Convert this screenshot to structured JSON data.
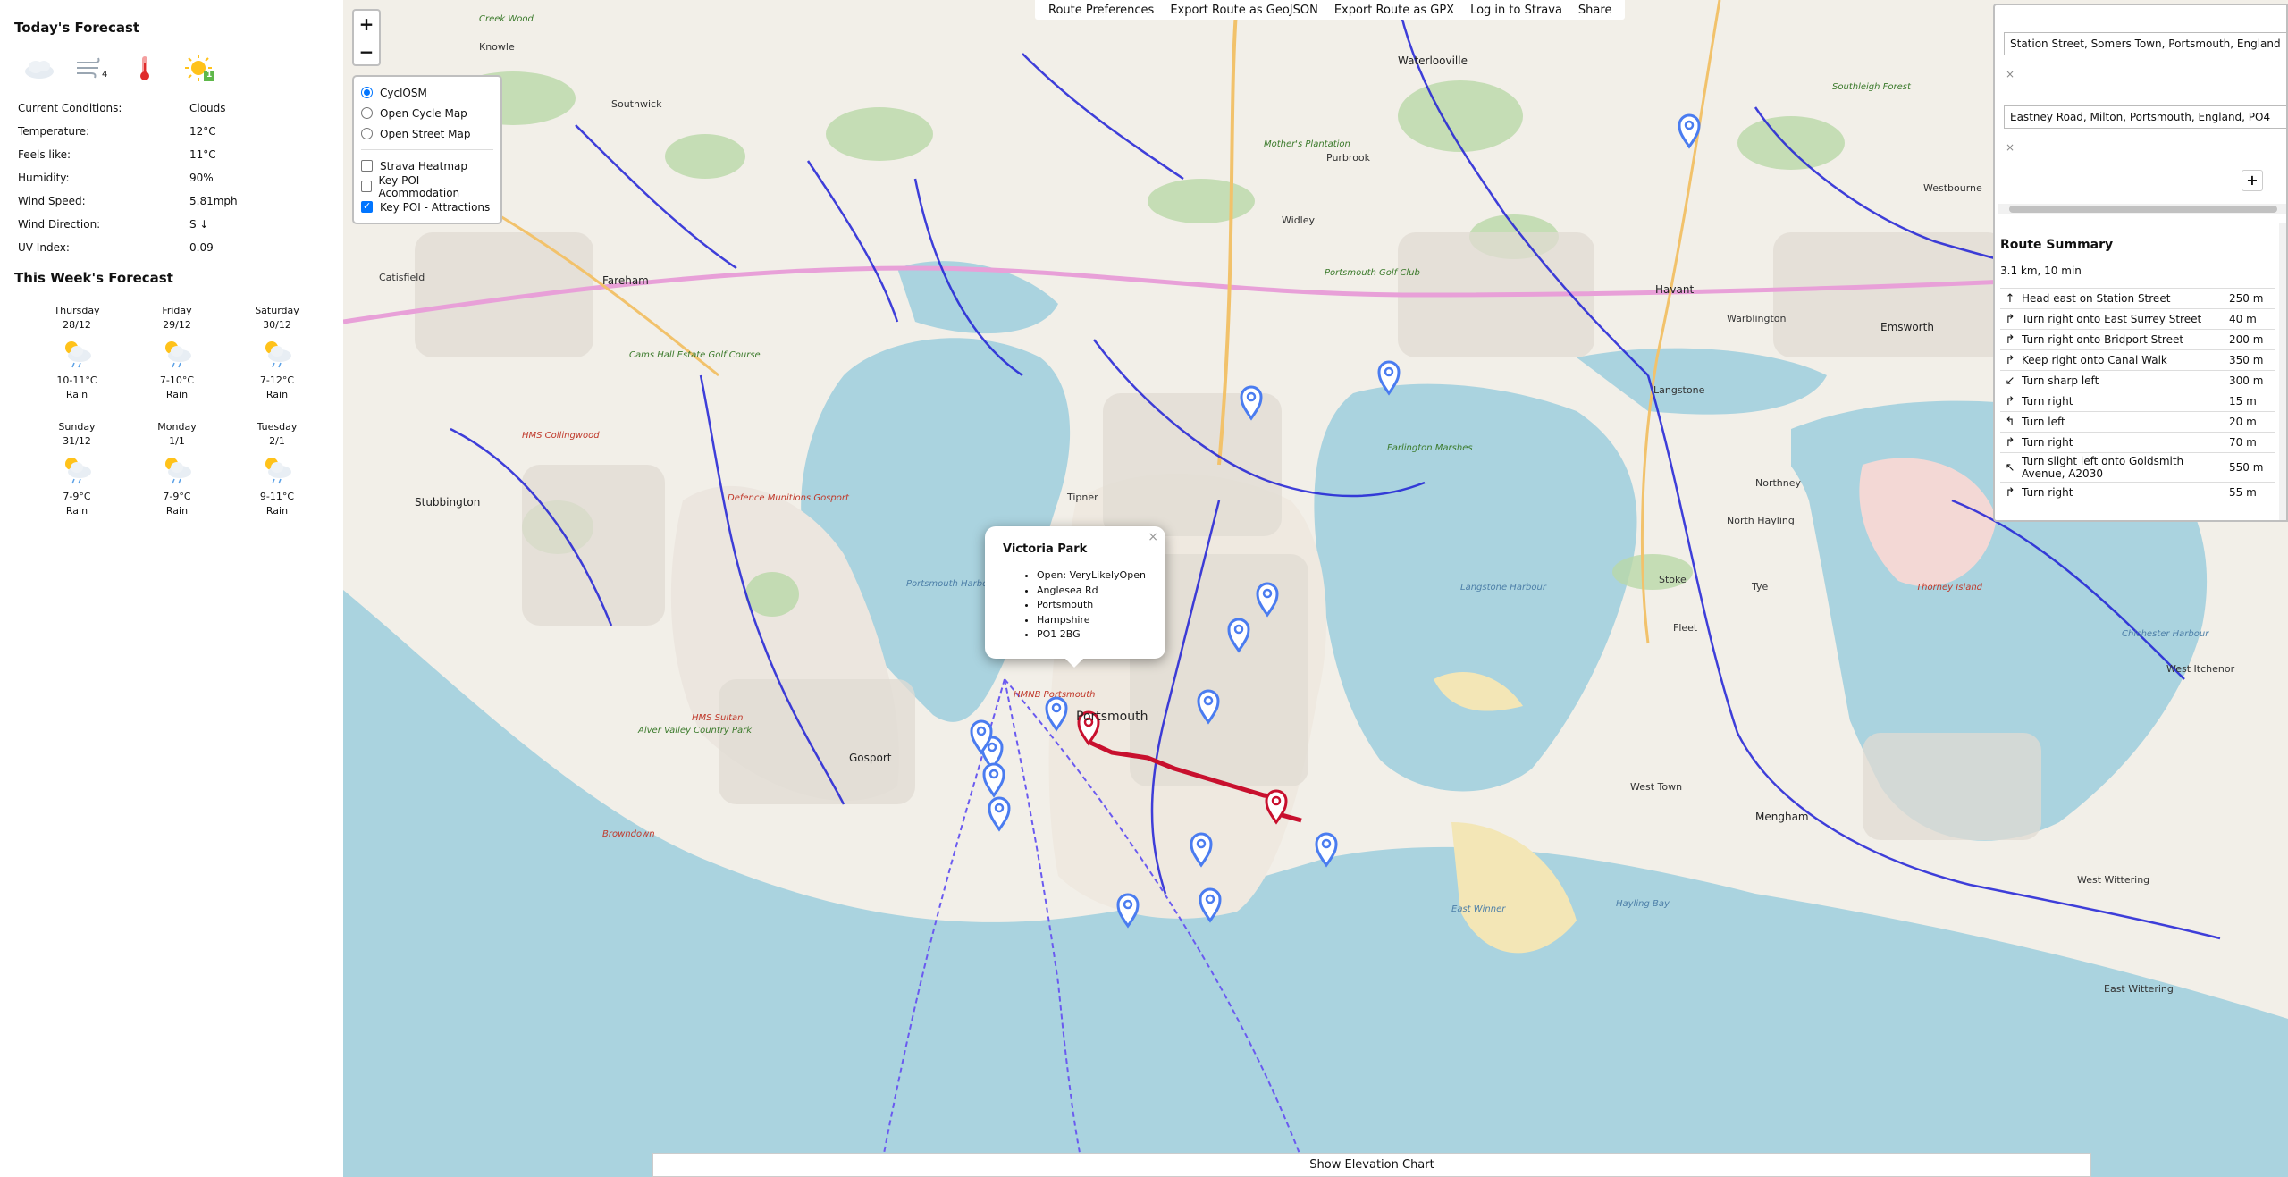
{
  "weather": {
    "today_title": "Today's Forecast",
    "today_icons": [
      {
        "icon": "cloud-icon"
      },
      {
        "icon": "wind-icon",
        "value": "4"
      },
      {
        "icon": "thermometer-icon"
      },
      {
        "icon": "uv-sun-icon",
        "value": "1"
      }
    ],
    "conditions": [
      {
        "label": "Current Conditions:",
        "value": "Clouds"
      },
      {
        "label": "Temperature:",
        "value": "12°C"
      },
      {
        "label": "Feels like:",
        "value": "11°C"
      },
      {
        "label": "Humidity:",
        "value": "90%"
      },
      {
        "label": "Wind Speed:",
        "value": "5.81mph"
      },
      {
        "label": "Wind Direction:",
        "value": "S ↓"
      },
      {
        "label": "UV Index:",
        "value": "0.09"
      }
    ],
    "week_title": "This Week's Forecast",
    "days": [
      {
        "day": "Thursday",
        "date": "28/12",
        "temp": "10-11°C",
        "cond": "Rain"
      },
      {
        "day": "Friday",
        "date": "29/12",
        "temp": "7-10°C",
        "cond": "Rain"
      },
      {
        "day": "Saturday",
        "date": "30/12",
        "temp": "7-12°C",
        "cond": "Rain"
      },
      {
        "day": "Sunday",
        "date": "31/12",
        "temp": "7-9°C",
        "cond": "Rain"
      },
      {
        "day": "Monday",
        "date": "1/1",
        "temp": "7-9°C",
        "cond": "Rain"
      },
      {
        "day": "Tuesday",
        "date": "2/1",
        "temp": "9-11°C",
        "cond": "Rain"
      }
    ]
  },
  "map": {
    "zoom_in": "+",
    "zoom_out": "−",
    "layers": {
      "base": [
        {
          "label": "CyclOSM",
          "selected": true
        },
        {
          "label": "Open Cycle Map",
          "selected": false
        },
        {
          "label": "Open Street Map",
          "selected": false
        }
      ],
      "overlays": [
        {
          "label": "Strava Heatmap",
          "checked": false
        },
        {
          "label": "Key POI - Acommodation",
          "checked": false
        },
        {
          "label": "Key POI - Attractions",
          "checked": true
        }
      ]
    },
    "menu": [
      "Route Preferences",
      "Export Route as GeoJSON",
      "Export Route as GPX",
      "Log in to Strava",
      "Share"
    ],
    "popup": {
      "title": "Victoria Park",
      "close": "×",
      "items": [
        "Open: VeryLikelyOpen",
        "Anglesea Rd",
        "Portsmouth",
        "Hampshire",
        "PO1 2BG"
      ]
    },
    "labels": [
      {
        "text": "Waterlooville",
        "cls": "town"
      },
      {
        "text": "Havant",
        "cls": "town"
      },
      {
        "text": "Emsworth",
        "cls": "town"
      },
      {
        "text": "Fareham",
        "cls": "town"
      },
      {
        "text": "Stubbington",
        "cls": "town"
      },
      {
        "text": "Gosport",
        "cls": "town"
      },
      {
        "text": "Portsmouth",
        "cls": "city"
      },
      {
        "text": "Southwick",
        "cls": "small"
      },
      {
        "text": "Purbrook",
        "cls": "small"
      },
      {
        "text": "Widley",
        "cls": "small"
      },
      {
        "text": "Catisfield",
        "cls": "small"
      },
      {
        "text": "Knowle",
        "cls": "small"
      },
      {
        "text": "Warblington",
        "cls": "small"
      },
      {
        "text": "Westbourne",
        "cls": "small"
      },
      {
        "text": "Langstone",
        "cls": "small"
      },
      {
        "text": "Northney",
        "cls": "small"
      },
      {
        "text": "North Hayling",
        "cls": "small"
      },
      {
        "text": "Stoke",
        "cls": "small"
      },
      {
        "text": "Tye",
        "cls": "small"
      },
      {
        "text": "Fleet",
        "cls": "small"
      },
      {
        "text": "West Town",
        "cls": "small"
      },
      {
        "text": "Mengham",
        "cls": "town"
      },
      {
        "text": "Tipner",
        "cls": "small"
      },
      {
        "text": "West Wittering",
        "cls": "small"
      },
      {
        "text": "East Wittering",
        "cls": "small"
      },
      {
        "text": "West Itchenor",
        "cls": "small"
      },
      {
        "text": "Portsmouth Harbour",
        "cls": "water"
      },
      {
        "text": "Langstone Harbour",
        "cls": "water"
      },
      {
        "text": "Chichester Harbour",
        "cls": "water"
      },
      {
        "text": "East Winner",
        "cls": "water"
      },
      {
        "text": "Hayling Bay",
        "cls": "water"
      },
      {
        "text": "Thorney Island",
        "cls": "red"
      },
      {
        "text": "HMS Collingwood",
        "cls": "red"
      },
      {
        "text": "HMS Sultan",
        "cls": "red"
      },
      {
        "text": "HMNB Portsmouth",
        "cls": "red"
      },
      {
        "text": "Defence Munitions Gosport",
        "cls": "red"
      },
      {
        "text": "Browndown",
        "cls": "red"
      },
      {
        "text": "Alver Valley Country Park",
        "cls": "green"
      },
      {
        "text": "Farlington Marshes",
        "cls": "green"
      },
      {
        "text": "Portsmouth Golf Club",
        "cls": "green"
      },
      {
        "text": "Cams Hall Estate Golf Course",
        "cls": "green"
      },
      {
        "text": "Mother's Plantation",
        "cls": "green"
      },
      {
        "text": "Southleigh Forest",
        "cls": "green"
      },
      {
        "text": "Creek Wood",
        "cls": "green"
      }
    ]
  },
  "routing": {
    "from": "Station Street, Somers Town, Portsmouth, England",
    "to": "Eastney Road, Milton, Portsmouth, England, PO4",
    "remove": "×",
    "add": "+",
    "summary_title": "Route Summary",
    "summary": "3.1 km, 10 min",
    "instructions": [
      {
        "icon": "arrow-up-icon",
        "text": "Head east on Station Street",
        "dist": "250 m"
      },
      {
        "icon": "turn-right-icon",
        "text": "Turn right onto East Surrey Street",
        "dist": "40 m"
      },
      {
        "icon": "turn-right-icon",
        "text": "Turn right onto Bridport Street",
        "dist": "200 m"
      },
      {
        "icon": "keep-right-icon",
        "text": "Keep right onto Canal Walk",
        "dist": "350 m"
      },
      {
        "icon": "sharp-left-icon",
        "text": "Turn sharp left",
        "dist": "300 m"
      },
      {
        "icon": "turn-right-icon",
        "text": "Turn right",
        "dist": "15 m"
      },
      {
        "icon": "turn-left-icon",
        "text": "Turn left",
        "dist": "20 m"
      },
      {
        "icon": "turn-right-icon",
        "text": "Turn right",
        "dist": "70 m"
      },
      {
        "icon": "slight-left-icon",
        "text": "Turn slight left onto Goldsmith Avenue, A2030",
        "dist": "550 m"
      },
      {
        "icon": "turn-right-icon",
        "text": "Turn right",
        "dist": "55 m"
      }
    ]
  },
  "elevation_button": "Show Elevation Chart",
  "colors": {
    "water": "#aad3df",
    "land": "#f2efe8",
    "route": "#c8102e",
    "cycle_path": "#1f1fd6",
    "poi_marker": "#4a7cf0"
  }
}
